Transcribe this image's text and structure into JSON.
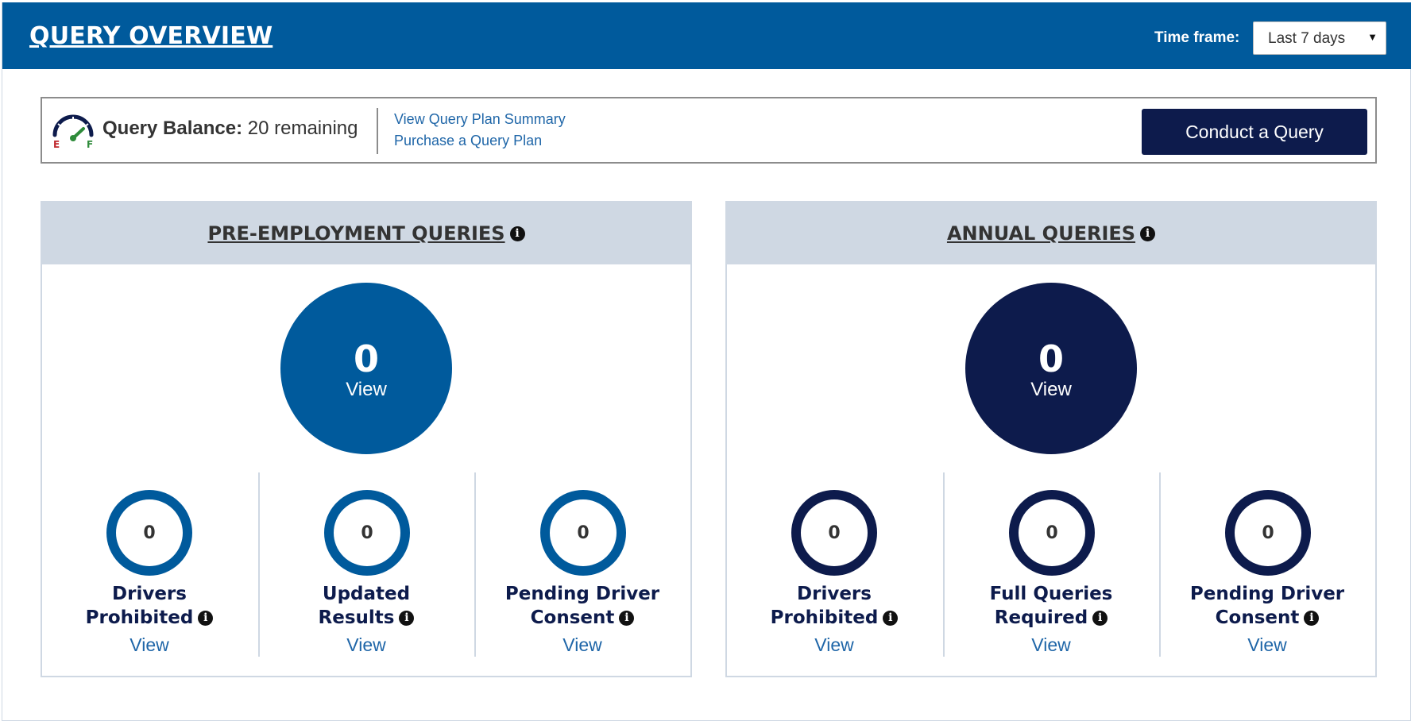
{
  "header": {
    "title": "QUERY OVERVIEW",
    "timeframe_label": "Time frame:",
    "timeframe_value": "Last 7 days"
  },
  "balance": {
    "label": "Query Balance:",
    "value": "20 remaining",
    "gauge_empty": "E",
    "gauge_full": "F",
    "link_summary": "View Query Plan Summary",
    "link_purchase": "Purchase a Query Plan",
    "conduct_button": "Conduct a Query"
  },
  "panels": [
    {
      "title": "PRE-EMPLOYMENT QUERIES",
      "total": "0",
      "total_view": "View",
      "accent": "#005a9c",
      "stats": [
        {
          "count": "0",
          "line1": "Drivers",
          "line2": "Prohibited",
          "view": "View"
        },
        {
          "count": "0",
          "line1": "Updated",
          "line2": "Results",
          "view": "View"
        },
        {
          "count": "0",
          "line1": "Pending Driver",
          "line2": "Consent",
          "view": "View"
        }
      ]
    },
    {
      "title": "ANNUAL QUERIES",
      "total": "0",
      "total_view": "View",
      "accent": "#0d1b4c",
      "stats": [
        {
          "count": "0",
          "line1": "Drivers",
          "line2": "Prohibited",
          "view": "View"
        },
        {
          "count": "0",
          "line1": "Full Queries",
          "line2": "Required",
          "view": "View"
        },
        {
          "count": "0",
          "line1": "Pending Driver",
          "line2": "Consent",
          "view": "View"
        }
      ]
    }
  ],
  "info_glyph": "i"
}
